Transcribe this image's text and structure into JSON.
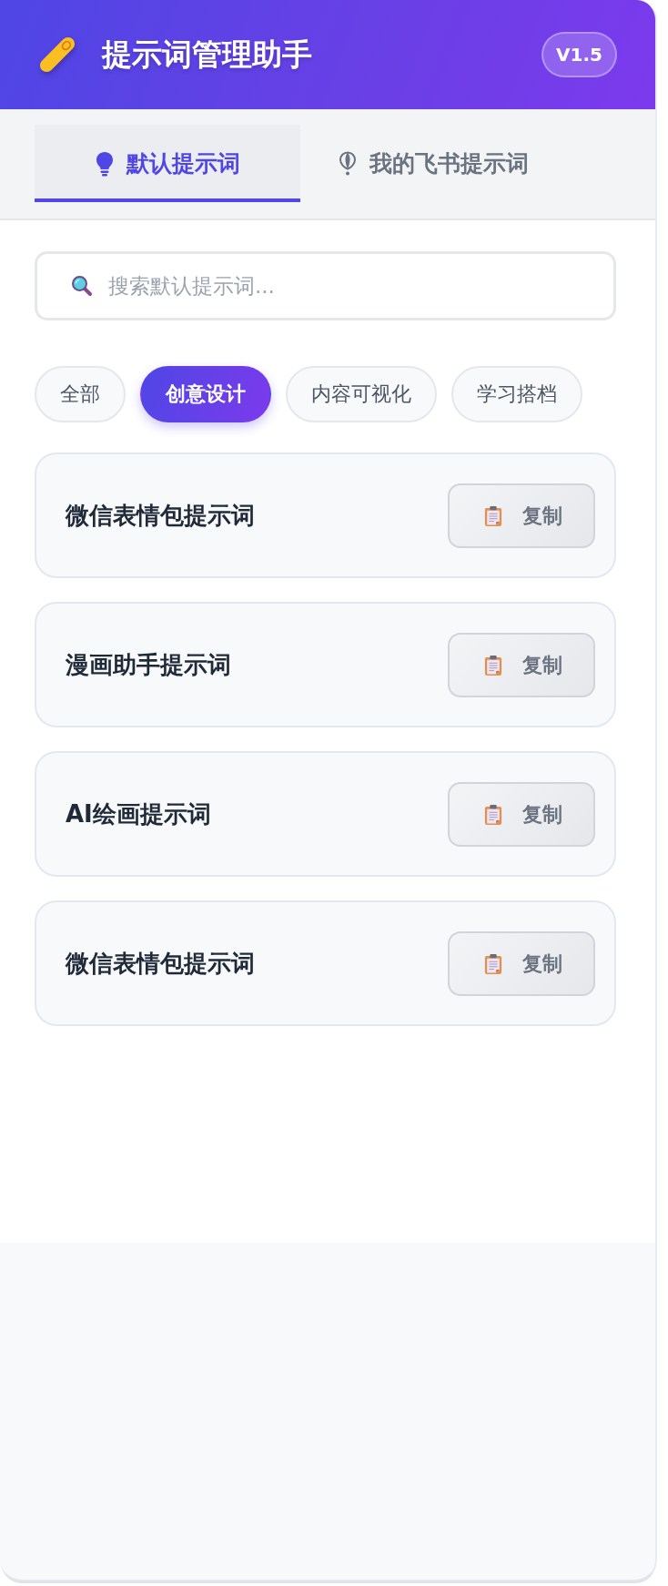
{
  "header": {
    "title": "提示词管理助手",
    "version": "V1.5"
  },
  "tabs": [
    {
      "label": "默认提示词",
      "selected": true
    },
    {
      "label": "我的飞书提示词",
      "selected": false
    }
  ],
  "search": {
    "placeholder": "搜索默认提示词..."
  },
  "categories": [
    {
      "label": "全部",
      "selected": false
    },
    {
      "label": "创意设计",
      "selected": true
    },
    {
      "label": "内容可视化",
      "selected": false
    },
    {
      "label": "学习搭档",
      "selected": false
    }
  ],
  "prompts": [
    {
      "title": "微信表情包提示词",
      "action": "复制"
    },
    {
      "title": "漫画助手提示词",
      "action": "复制"
    },
    {
      "title": "AI绘画提示词",
      "action": "复制"
    },
    {
      "title": "微信表情包提示词",
      "action": "复制"
    }
  ]
}
